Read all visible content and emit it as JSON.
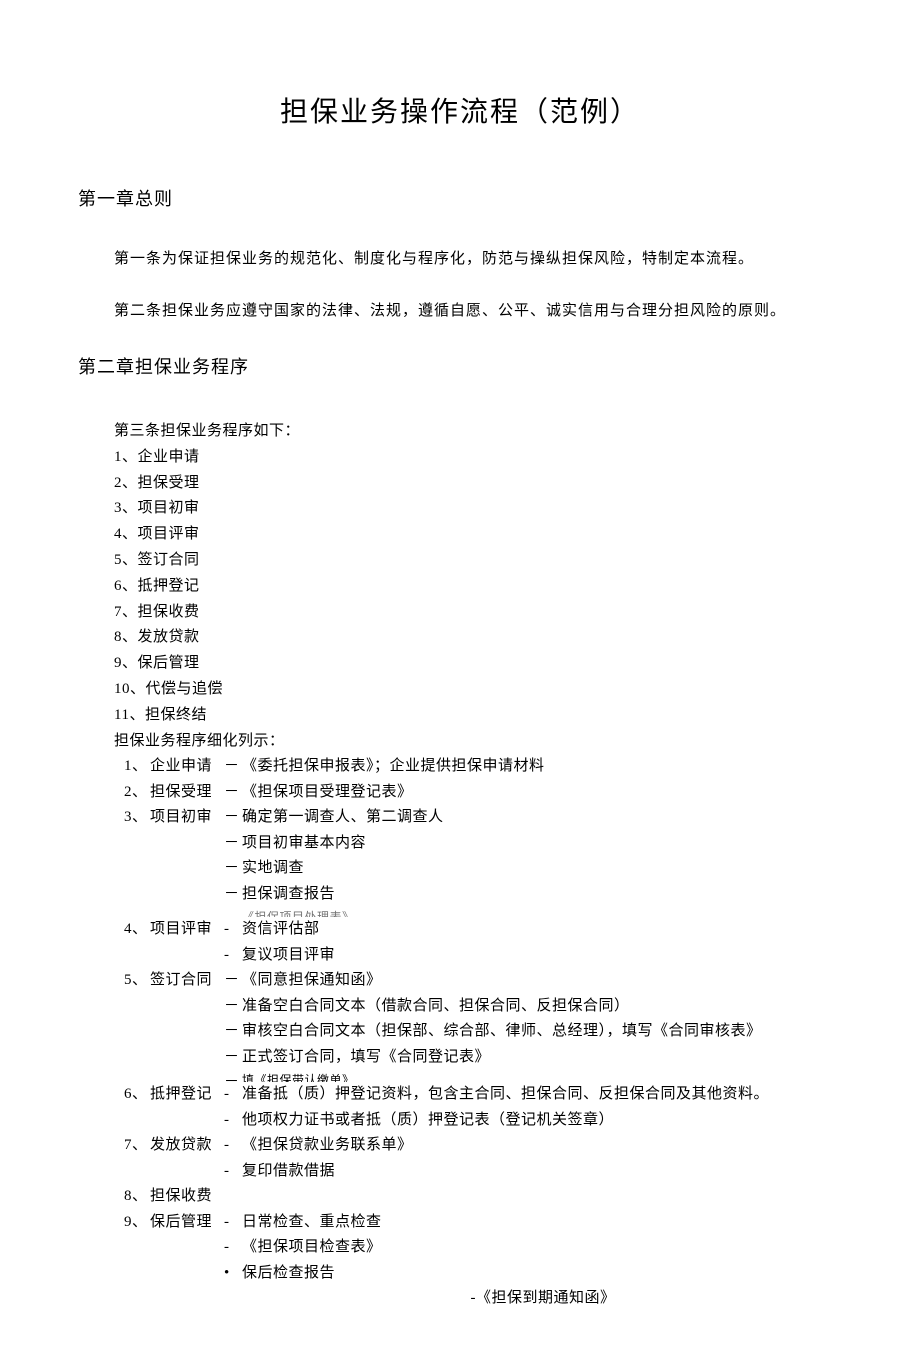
{
  "title": "担保业务操作流程（范例）",
  "chapters": {
    "c1": "第一章总则",
    "c2": "第二章担保业务程序"
  },
  "paras": {
    "p1": "第一条为保证担保业务的规范化、制度化与程序化，防范与操纵担保风险，特制定本流程。",
    "p2": "第二条担保业务应遵守国家的法律、法规，遵循自愿、公平、诚实信用与合理分担风险的原则。",
    "p3": "第三条担保业务程序如下："
  },
  "steps": {
    "s1": "1、企业申请",
    "s2": "2、担保受理",
    "s3": "3、项目初审",
    "s4": "4、项目评审",
    "s5": "5、签订合同",
    "s6": "6、抵押登记",
    "s7": "7、担保收费",
    "s8": "8、发放贷款",
    "s9": "9、保后管理",
    "s10": "10、代偿与追偿",
    "s11": "11、担保终结"
  },
  "detail_title": "担保业务程序细化列示：",
  "d": {
    "i1": "1、",
    "l1": "企业申请",
    "c1": "《委托担保申报表》；企业提供担保申请材料",
    "i2": "2、",
    "l2": "担保受理",
    "c2": "《担保项目受理登记表》",
    "i3": "3、",
    "l3": "项目初审",
    "c3a": "确定第一调查人、第二调查人",
    "c3b": "项目初审基本内容",
    "c3c": "实地调查",
    "c3d": "担保调查报告",
    "c3e": "《担保项目处理表》",
    "i4": "4、",
    "l4": "项目评审",
    "c4a": "资信评估部",
    "c4b": "复议项目评审",
    "i5": "5、",
    "l5": "签订合同",
    "c5a": "《同意担保通知函》",
    "c5b": "准备空白合同文本（借款合同、担保合同、反担保合同）",
    "c5c": "审核空白合同文本（担保部、综合部、律师、总经理），填写《合同审核表》",
    "c5d": "正式签订合同，填写《合同登记表》",
    "c5e": "填《担保带认缴单》",
    "i6": "6、",
    "l6": "抵押登记",
    "c6a": "准备抵（质）押登记资料，包含主合同、担保合同、反担保合同及其他资料。",
    "c6b": "他项权力证书或者抵（质）押登记表（登记机关签章）",
    "i7": "7、",
    "l7": "发放贷款",
    "c7a": "《担保贷款业务联系单》",
    "c7b": "复印借款借据",
    "i8": "8、",
    "l8": "担保收费",
    "i9": "9、",
    "l9": "保后管理",
    "c9a": "日常检查、重点检查",
    "c9b": "《担保项目检查表》",
    "c9c": "保后检查报告",
    "c9d": "《担保到期通知函》"
  },
  "dash": "－",
  "dash2": "-",
  "bullet": "•"
}
